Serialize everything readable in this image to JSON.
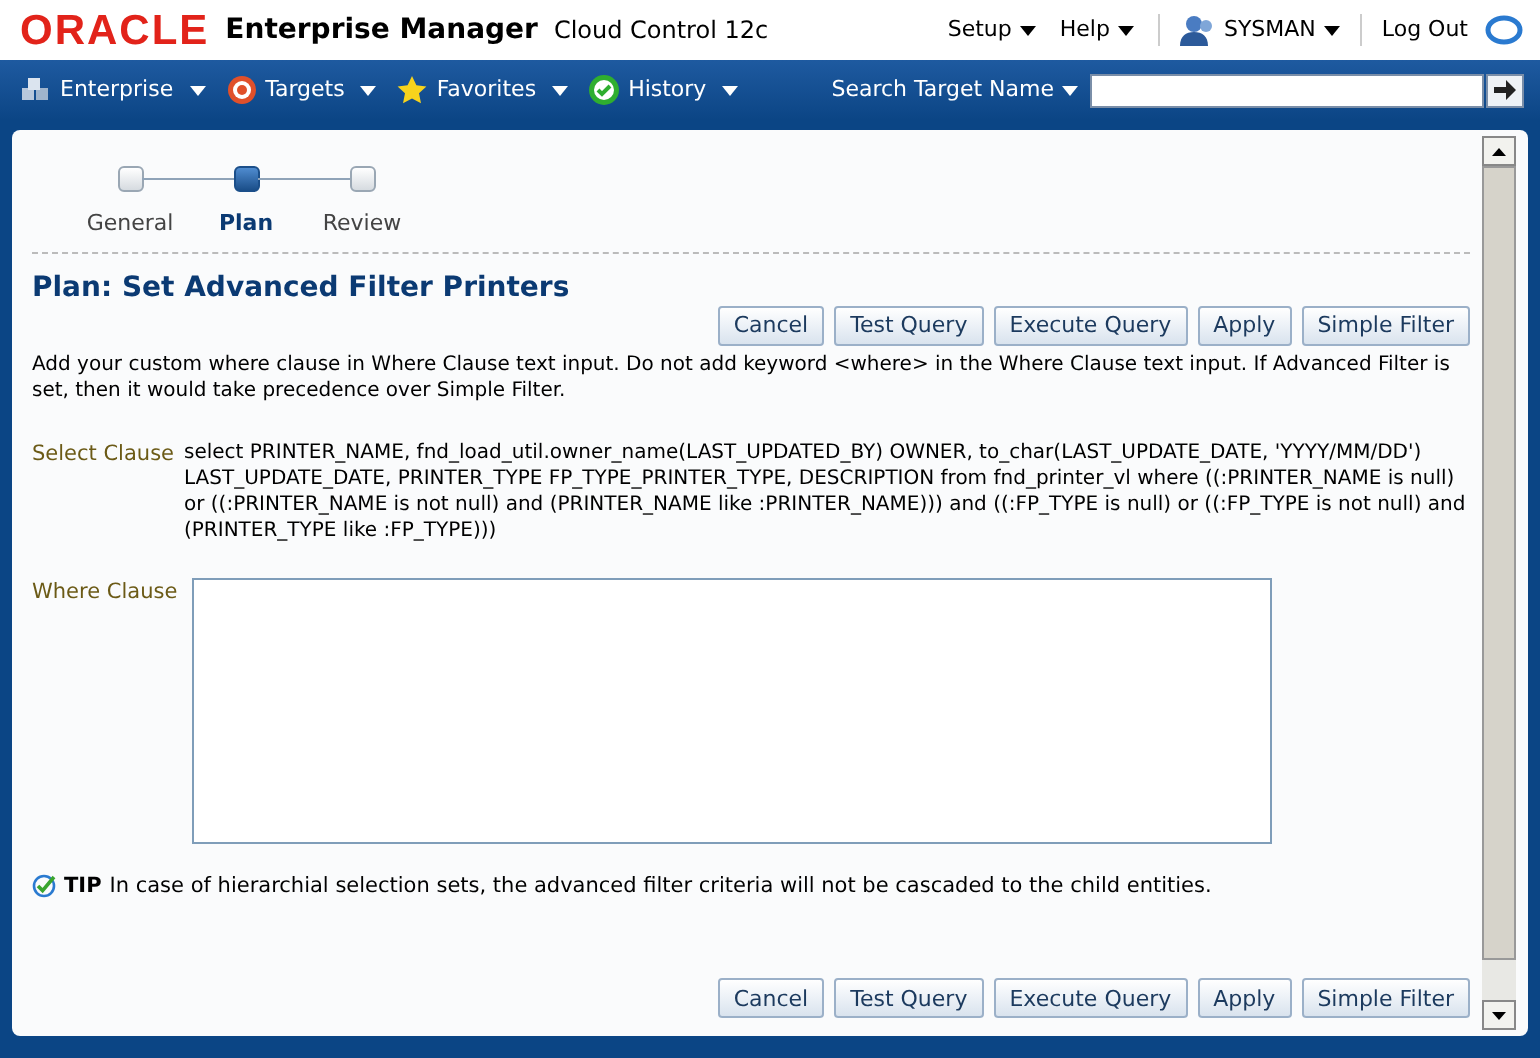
{
  "header": {
    "logo": "ORACLE",
    "product": "Enterprise Manager",
    "edition": "Cloud Control 12c",
    "menus": [
      "Setup",
      "Help"
    ],
    "user": "SYSMAN",
    "logout": "Log Out"
  },
  "nav": {
    "items": [
      {
        "label": "Enterprise",
        "kind": "enterprise"
      },
      {
        "label": "Targets",
        "kind": "targets"
      },
      {
        "label": "Favorites",
        "kind": "favorites"
      },
      {
        "label": "History",
        "kind": "history"
      }
    ],
    "search_label": "Search Target Name"
  },
  "train": [
    {
      "label": "General",
      "selected": false
    },
    {
      "label": "Plan",
      "selected": true
    },
    {
      "label": "Review",
      "selected": false
    }
  ],
  "title": "Plan: Set Advanced Filter Printers",
  "buttons_top": [
    "Cancel",
    "Test Query",
    "Execute Query",
    "Apply",
    "Simple Filter"
  ],
  "instructions": "Add your custom where clause in Where Clause text input. Do not add keyword <where> in the Where Clause text input. If Advanced Filter is set, then it would take precedence over Simple Filter.",
  "select_clause": {
    "label": "Select Clause",
    "value": "select PRINTER_NAME, fnd_load_util.owner_name(LAST_UPDATED_BY) OWNER, to_char(LAST_UPDATE_DATE, 'YYYY/MM/DD') LAST_UPDATE_DATE, PRINTER_TYPE FP_TYPE_PRINTER_TYPE, DESCRIPTION from fnd_printer_vl where ((:PRINTER_NAME is null) or ((:PRINTER_NAME is not null) and (PRINTER_NAME like :PRINTER_NAME))) and ((:FP_TYPE is null) or ((:FP_TYPE is not null) and (PRINTER_TYPE like :FP_TYPE)))"
  },
  "where_clause": {
    "label": "Where Clause"
  },
  "tip": {
    "label": "TIP",
    "text": "In case of hierarchial selection sets, the advanced filter criteria will not be cascaded to the child entities."
  },
  "buttons_bottom": [
    "Cancel",
    "Test Query",
    "Execute Query",
    "Apply",
    "Simple Filter"
  ]
}
